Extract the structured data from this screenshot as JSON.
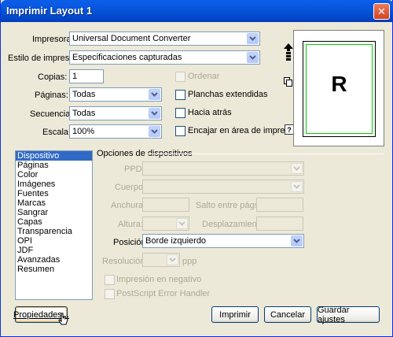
{
  "window": {
    "title": "Imprimir Layout 1",
    "close_label": "✕"
  },
  "main": {
    "printer_label": "Impresora:",
    "printer_value": "Universal Document Converter",
    "style_label": "Estilo de impresión:",
    "style_value": "Especificaciones capturadas",
    "copies_label": "Copias:",
    "copies_value": "1",
    "pages_label": "Páginas:",
    "pages_value": "Todas",
    "sequence_label": "Secuencia:",
    "sequence_value": "Todas",
    "scale_label": "Escala:",
    "scale_value": "100%",
    "collate_label": "Ordenar",
    "spreads_label": "Planchas extendidas",
    "reverse_label": "Hacia atrás",
    "fit_label": "Encajar en área de impresión",
    "help_label": "?"
  },
  "preview": {
    "letter": "R"
  },
  "categories": [
    "Dispositivo",
    "Páginas",
    "Color",
    "Imágenes",
    "Fuentes",
    "Marcas",
    "Sangrar",
    "Capas",
    "Transparencia",
    "OPI",
    "JDF",
    "Avanzadas",
    "Resumen"
  ],
  "selected_category": "Dispositivo",
  "device": {
    "group_label": "Opciones de dispositivos",
    "ppd_label": "PPD:",
    "body_label": "Cuerpo:",
    "width_label": "Anchura:",
    "gap_label": "Salto entre págs.:",
    "height_label": "Altura:",
    "offset_label": "Desplazamiento:",
    "position_label": "Posición:",
    "position_value": "Borde izquierdo",
    "resolution_label": "Resolución:",
    "resolution_unit": "ppp",
    "negative_label": "Impresión en negativo",
    "error_handler_label": "PostScript Error Handler"
  },
  "buttons": {
    "properties": "Propiedades...",
    "print": "Imprimir",
    "cancel": "Cancelar",
    "save": "Guardar ajustes"
  },
  "colors": {
    "title_bar": "#0453d7",
    "selection": "#316ac5",
    "preview_margin": "#00d000"
  }
}
